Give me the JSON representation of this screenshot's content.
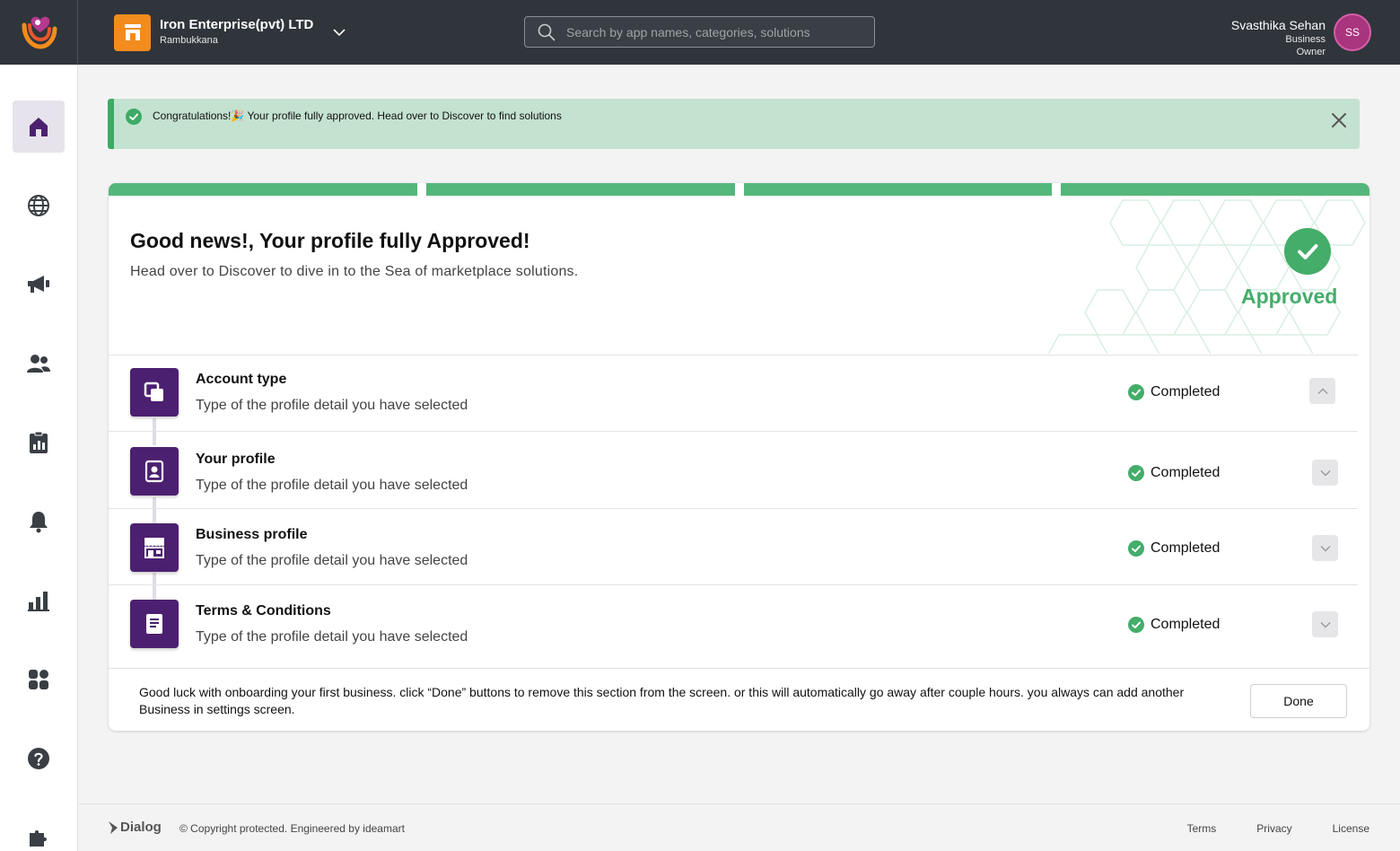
{
  "header": {
    "org_name": "Iron Enterprise(pvt) LTD",
    "org_location": "Rambukkana",
    "search_placeholder": "Search by app names, categories, solutions",
    "user_name": "Svasthika Sehan",
    "user_role": "Business Owner",
    "user_initials": "SS"
  },
  "sidebar": {
    "items": [
      {
        "icon": "home-icon",
        "active": true
      },
      {
        "icon": "globe-icon"
      },
      {
        "icon": "megaphone-icon"
      },
      {
        "icon": "users-icon"
      },
      {
        "icon": "clipboard-chart-icon"
      },
      {
        "icon": "bell-icon"
      },
      {
        "icon": "bar-chart-icon"
      },
      {
        "icon": "apps-icon"
      },
      {
        "icon": "help-icon"
      },
      {
        "icon": "puzzle-icon"
      }
    ]
  },
  "alert": {
    "text": "Congratulations!🎉 Your profile fully approved. Head over to Discover to find solutions"
  },
  "card": {
    "progress_segments": 4,
    "title": "Good news!, Your profile fully Approved!",
    "subtitle": "Head over to Discover to dive in to the Sea of marketplace solutions.",
    "approved_label": "Approved",
    "steps": [
      {
        "title": "Account type",
        "description": "Type of the profile detail you have selected",
        "status": "Completed",
        "icon": "copy-icon",
        "expanded": true
      },
      {
        "title": "Your profile",
        "description": "Type of the profile detail you have selected",
        "status": "Completed",
        "icon": "id-badge-icon",
        "expanded": false
      },
      {
        "title": "Business profile",
        "description": "Type of the profile detail you have selected",
        "status": "Completed",
        "icon": "store-icon",
        "expanded": false
      },
      {
        "title": "Terms & Conditions",
        "description": "Type of the profile detail you have selected",
        "status": "Completed",
        "icon": "document-icon",
        "expanded": false
      }
    ],
    "footer_note": "Good luck with onboarding your first business. click “Done” buttons to remove this section from the screen. or this will automatically go away after couple hours. you always can add another Business in settings screen.",
    "done_label": "Done"
  },
  "footer": {
    "brand": "Dialog",
    "copyright": "© Copyright protected. Engineered by ideamart",
    "links": [
      "Terms",
      "Privacy",
      "License"
    ]
  },
  "colors": {
    "topbar": "#30353b",
    "accent_purple": "#4c2070",
    "success_green": "#44ad6a",
    "org_orange": "#f28c1e",
    "avatar": "#a8357d"
  }
}
